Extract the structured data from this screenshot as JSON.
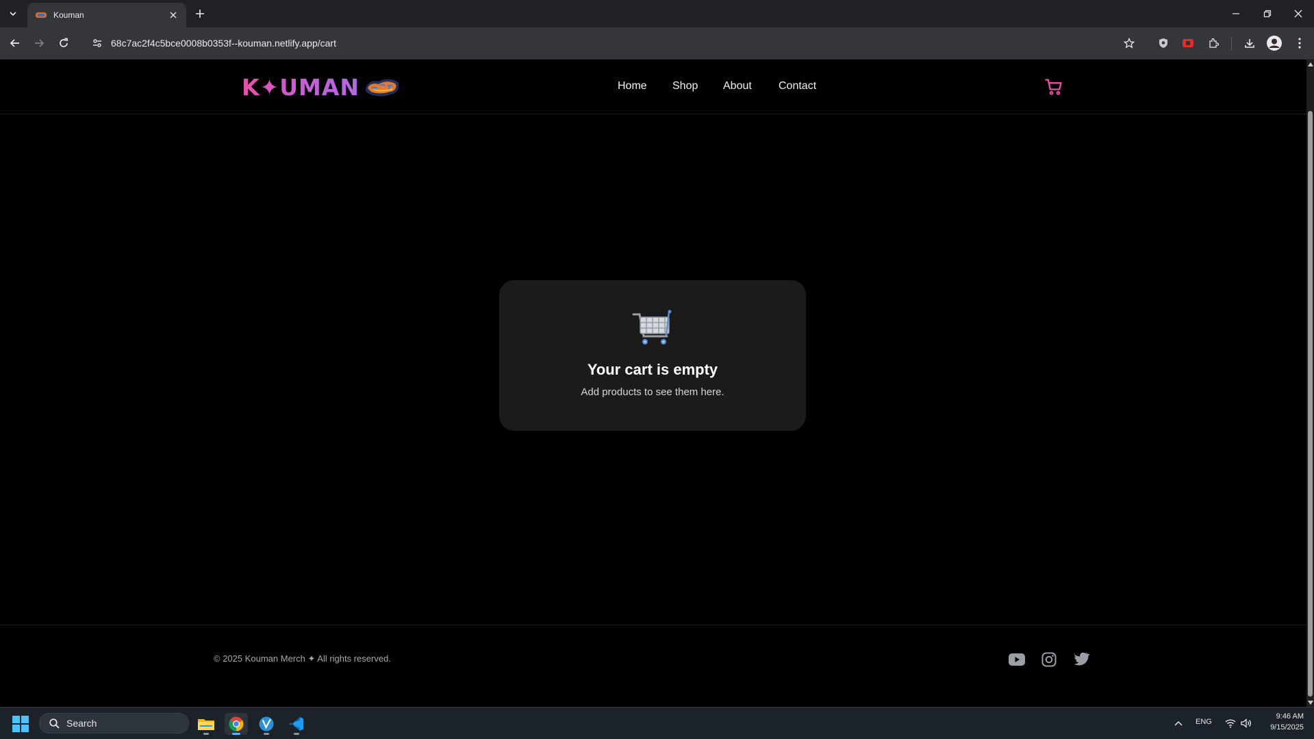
{
  "browser": {
    "tab_title": "Kouman",
    "url": "68c7ac2f4c5bce0008b0353f--kouman.netlify.app/cart"
  },
  "site": {
    "logo_text": "K✦UMAN",
    "nav": [
      "Home",
      "Shop",
      "About",
      "Contact"
    ],
    "accent_color": "#e94fa8"
  },
  "cart": {
    "empty_title": "Your cart is empty",
    "empty_subtitle": "Add products to see them here."
  },
  "footer": {
    "copyright": "© 2025 Kouman Merch ✦ All rights reserved.",
    "social": [
      "youtube-icon",
      "instagram-icon",
      "twitter-icon"
    ]
  },
  "taskbar": {
    "search_label": "Search",
    "language": "ENG",
    "time": "9:46 AM",
    "date": "9/15/2025"
  }
}
